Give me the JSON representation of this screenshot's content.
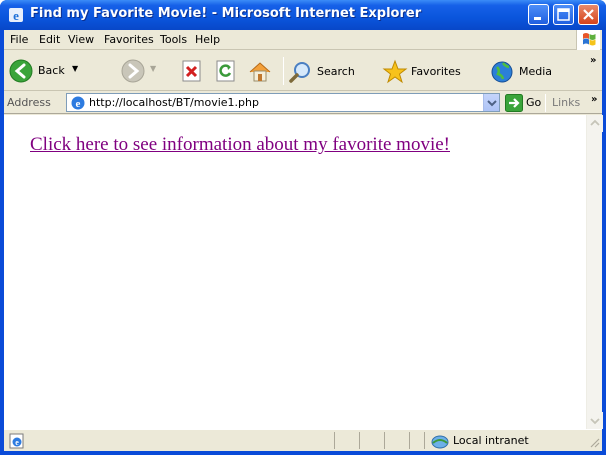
{
  "window": {
    "title": "Find my Favorite Movie! - Microsoft Internet Explorer"
  },
  "menu": [
    "File",
    "Edit",
    "View",
    "Favorites",
    "Tools",
    "Help"
  ],
  "toolbar": {
    "back_label": "Back",
    "search_label": "Search",
    "favorites_label": "Favorites",
    "media_label": "Media"
  },
  "address": {
    "label": "Address",
    "url": "http://localhost/BT/movie1.php",
    "go_label": "Go",
    "links_label": "Links"
  },
  "page": {
    "link_text": "Click here to see information about my favorite movie!"
  },
  "status": {
    "zone": "Local intranet"
  },
  "colors": {
    "titlebar": "#0a55dc",
    "visited_link": "#800080",
    "chrome": "#ece9d8"
  }
}
